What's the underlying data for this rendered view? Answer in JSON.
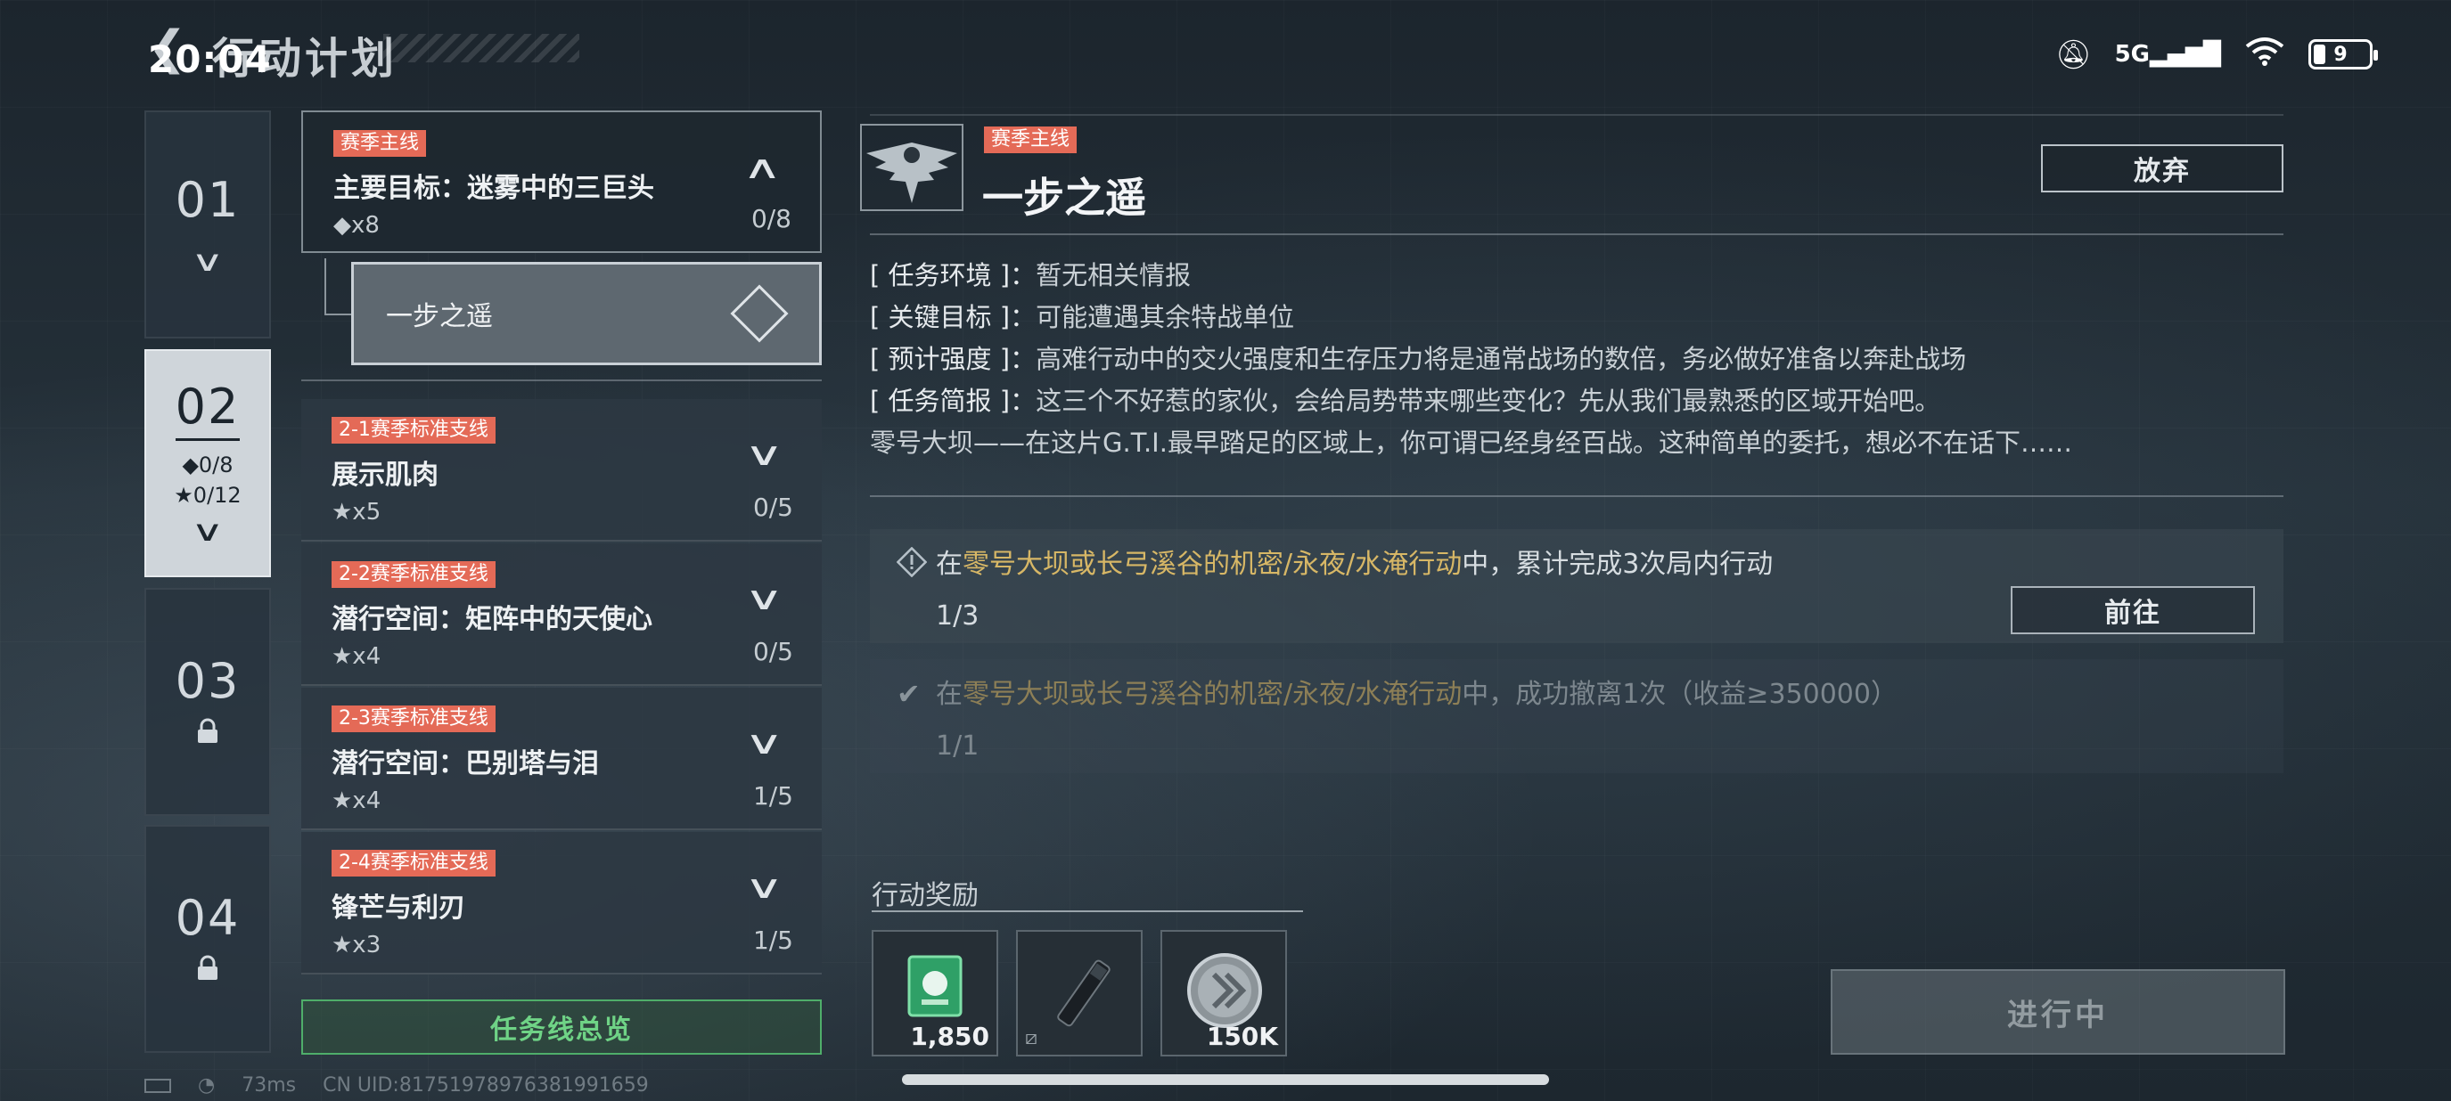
{
  "status_bar": {
    "time": "20:04",
    "network": "5G",
    "battery": "9"
  },
  "header": {
    "title": "行动计划"
  },
  "chapters": [
    {
      "num": "01"
    },
    {
      "num": "02",
      "main_progress": "◆0/8",
      "star_progress": "★0/12"
    },
    {
      "num": "03"
    },
    {
      "num": "04"
    }
  ],
  "missions": {
    "main": {
      "tag": "赛季主线",
      "title": "主要目标：迷雾中的三巨头",
      "reward": "◆x8",
      "progress": "0/8",
      "sub_item": "一步之遥"
    },
    "branches": [
      {
        "tag": "2-1赛季标准支线",
        "title": "展示肌肉",
        "reward": "★x5",
        "progress": "0/5"
      },
      {
        "tag": "2-2赛季标准支线",
        "title": "潜行空间：矩阵中的天使心",
        "reward": "★x4",
        "progress": "0/5"
      },
      {
        "tag": "2-3赛季标准支线",
        "title": "潜行空间：巴别塔与泪",
        "reward": "★x4",
        "progress": "1/5"
      },
      {
        "tag": "2-4赛季标准支线",
        "title": "锋芒与利刃",
        "reward": "★x3",
        "progress": "1/5"
      }
    ],
    "overview_label": "任务线总览"
  },
  "footer": {
    "ping": "73ms",
    "uid": "CN UID:81751978976381991659"
  },
  "detail": {
    "tag": "赛季主线",
    "title": "一步之遥",
    "abandon_label": "放弃",
    "lines": [
      {
        "key": "[ 任务环境 ]：",
        "value": "暂无相关情报"
      },
      {
        "key": "[ 关键目标 ]：",
        "value": "可能遭遇其余特战单位"
      },
      {
        "key": "[ 预计强度 ]：",
        "value": "高难行动中的交火强度和生存压力将是通常战场的数倍，务必做好准备以奔赴战场"
      },
      {
        "key": "[ 任务简报 ]：",
        "value": "这三个不好惹的家伙，会给局势带来哪些变化？先从我们最熟悉的区域开始吧。"
      }
    ],
    "brief_extra": "零号大坝——在这片G.T.I.最早踏足的区域上，你可谓已经身经百战。这种简单的委托，想必不在话下……",
    "tasks": [
      {
        "prefix": "在",
        "highlight": "零号大坝或长弓溪谷的机密/永夜/水淹行动",
        "suffix": "中，累计完成3次局内行动",
        "progress": "1/3",
        "button": "前往"
      },
      {
        "prefix": "在",
        "highlight": "零号大坝或长弓溪谷的机密/永夜/水淹行动",
        "suffix": "中，成功撤离1次（收益≥350000）",
        "progress": "1/1"
      }
    ],
    "rewards_title": "行动奖励",
    "rewards": [
      {
        "amount": "1,850"
      },
      {
        "amount": ""
      },
      {
        "amount": "150K"
      }
    ],
    "action_label": "进行中"
  },
  "colors": {
    "tag_red": "#e46a57",
    "highlight_gold": "#d7b766",
    "overview_green": "#6fd386"
  }
}
